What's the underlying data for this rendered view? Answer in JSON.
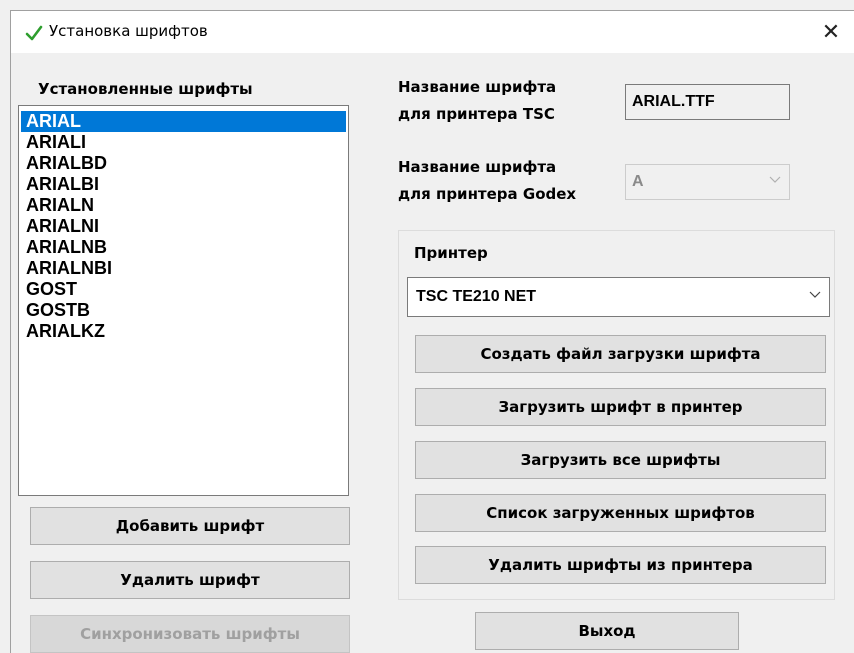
{
  "window": {
    "title": "Установка шрифтов",
    "icon": "checkmark-icon",
    "close_label": "✕"
  },
  "left": {
    "heading": "Установленные шрифты",
    "fonts": [
      "ARIAL",
      "ARIALI",
      "ARIALBD",
      "ARIALBI",
      "ARIALN",
      "ARIALNI",
      "ARIALNB",
      "ARIALNBI",
      "GOST",
      "GOSTB",
      "ARIALKZ"
    ],
    "selected": "ARIAL",
    "add_button": "Добавить шрифт",
    "delete_button": "Удалить шрифт",
    "sync_button": "Синхронизовать шрифты"
  },
  "right": {
    "tsc_label_line1": "Название шрифта",
    "tsc_label_line2": "для принтера TSC",
    "tsc_value": "ARIAL.TTF",
    "godex_label_line1": "Название шрифта",
    "godex_label_line2": "для принтера Godex",
    "godex_value": "A",
    "printer_label": "Принтер",
    "printer_value": "TSC TE210 NET",
    "buttons": {
      "create": "Создать файл загрузки шрифта",
      "upload": "Загрузить шрифт в принтер",
      "upload_all": "Загрузить все шрифты",
      "list_loaded": "Список загруженных шрифтов",
      "remove_from_printer": "Удалить шрифты из принтера"
    },
    "exit_button": "Выход"
  },
  "colors": {
    "selection": "#0078d7",
    "window_bg": "#f0f0f0",
    "button_bg": "#e1e1e1",
    "check_green": "#2e9e2e"
  }
}
